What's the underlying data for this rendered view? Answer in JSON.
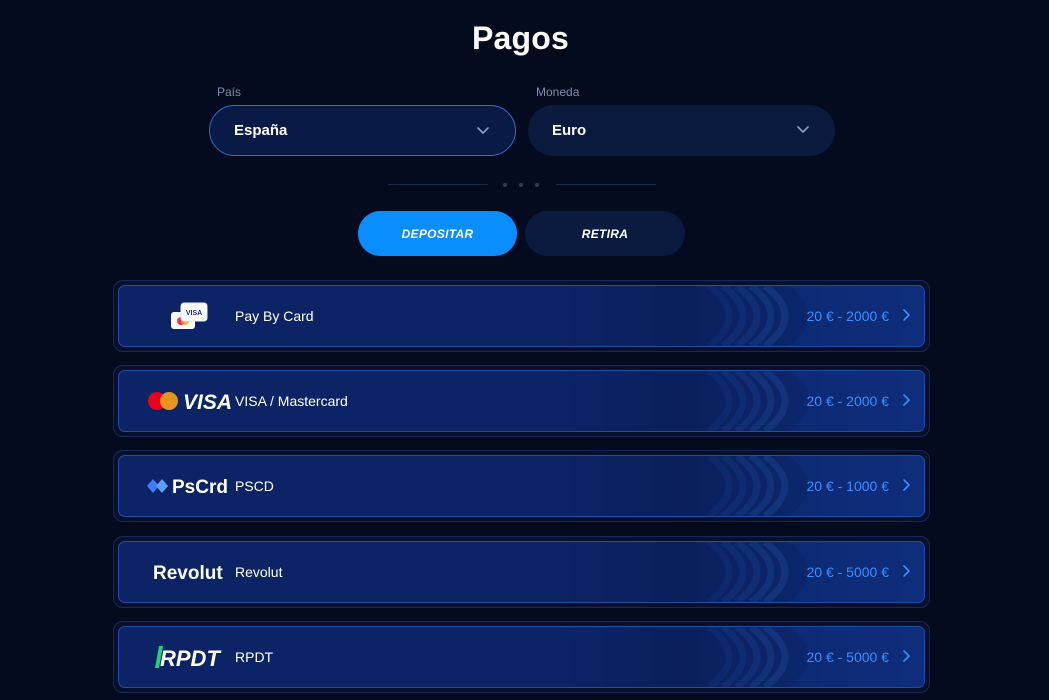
{
  "page": {
    "title": "Pagos"
  },
  "filters": {
    "country": {
      "label": "País",
      "value": "España"
    },
    "currency": {
      "label": "Moneda",
      "value": "Euro"
    }
  },
  "tabs": {
    "deposit": "DEPOSITAR",
    "withdraw": "RETIRA",
    "active": "deposit"
  },
  "colors": {
    "accent": "#0a8dff",
    "range": "#3b8fff",
    "background": "#040b1e"
  },
  "methods": [
    {
      "logo": "card-stack-icon",
      "logo_text": "VISA",
      "name": "Pay By Card",
      "range": "20 € - 2000 €"
    },
    {
      "logo": "mastercard-visa-logo",
      "logo_text": "VISA",
      "name": "VISA / Mastercard",
      "range": "20 € - 2000 €"
    },
    {
      "logo": "pscrd-logo",
      "logo_text": "PsCrd",
      "name": "PSCD",
      "range": "20 € - 1000 €"
    },
    {
      "logo": "revolut-logo",
      "logo_text": "Revolut",
      "name": "Revolut",
      "range": "20 € - 5000 €"
    },
    {
      "logo": "rpdt-logo",
      "logo_text": "RPDT",
      "name": "RPDT",
      "range": "20 € - 5000 €"
    }
  ]
}
